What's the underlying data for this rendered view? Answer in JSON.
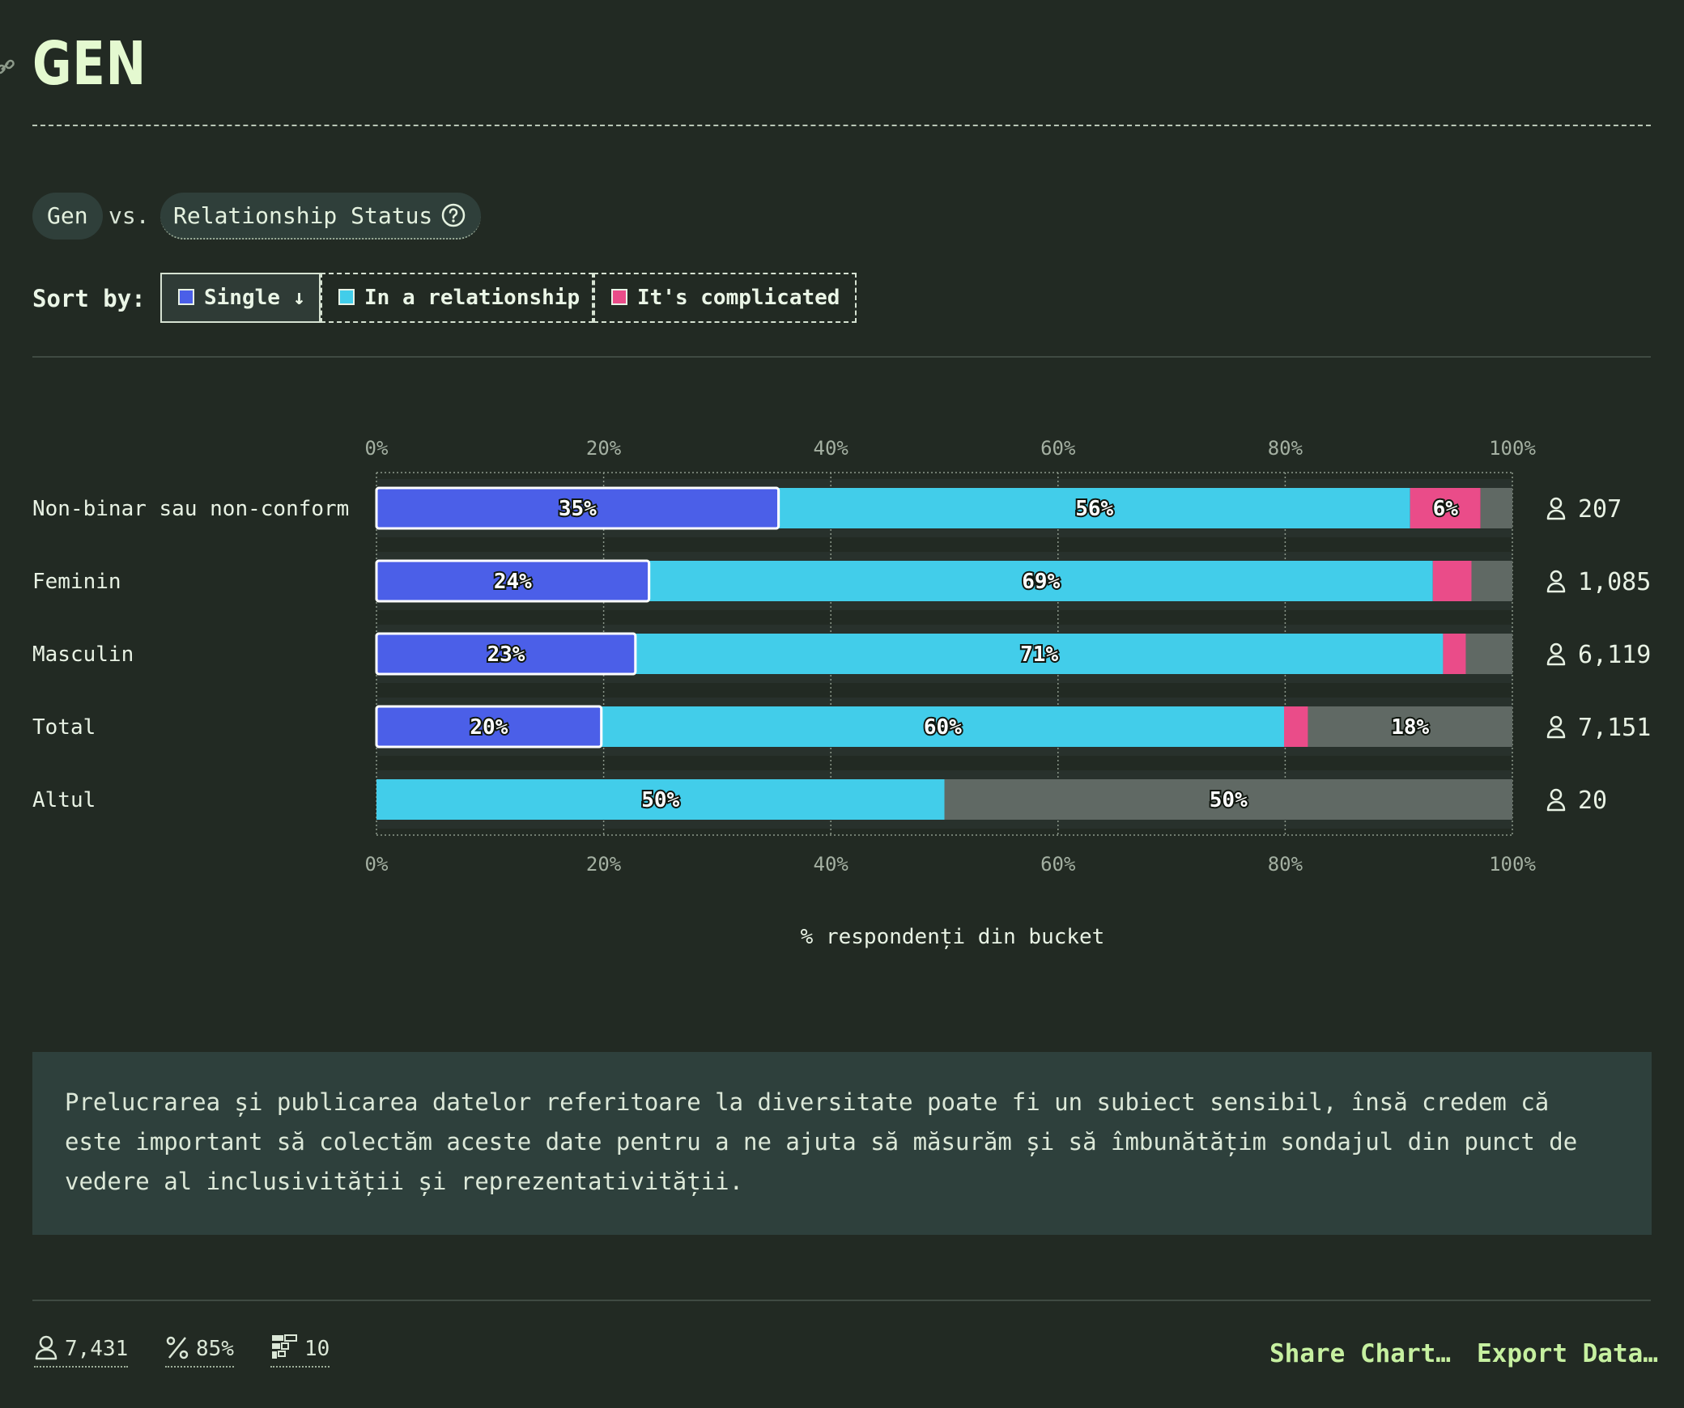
{
  "page": {
    "title": "GEN"
  },
  "comparison": {
    "variable_a": "Gen",
    "vs_label": "vs.",
    "variable_b": "Relationship Status"
  },
  "sort": {
    "label": "Sort by:",
    "options": [
      {
        "label": "Single ↓",
        "color": "#4b5fe8",
        "active": true
      },
      {
        "label": "In a relationship",
        "color": "#42cdea",
        "active": false
      },
      {
        "label": "It's complicated",
        "color": "#ea4c89",
        "active": false
      }
    ]
  },
  "chart_data": {
    "type": "bar",
    "orientation": "horizontal-stacked-100",
    "xlabel": "% respondenți din bucket",
    "xlim": [
      0,
      100
    ],
    "ticks": [
      "0%",
      "20%",
      "40%",
      "60%",
      "80%",
      "100%"
    ],
    "categories": [
      "Non-binar sau non-conform",
      "Feminin",
      "Masculin",
      "Total",
      "Altul"
    ],
    "counts": [
      "207",
      "1,085",
      "6,119",
      "7,151",
      "20"
    ],
    "series": [
      {
        "name": "Single",
        "color": "#4b5fe8",
        "values": [
          35.4,
          24.0,
          22.8,
          19.8,
          0
        ]
      },
      {
        "name": "In a relationship",
        "color": "#42cdea",
        "values": [
          55.6,
          69.0,
          71.1,
          60.1,
          50
        ]
      },
      {
        "name": "It's complicated",
        "color": "#ea4c89",
        "values": [
          6.2,
          3.4,
          2.0,
          2.1,
          0
        ]
      },
      {
        "color": "#606964",
        "values": [
          2.8,
          3.6,
          4.1,
          18.0,
          50
        ]
      }
    ],
    "data_labels": [
      [
        "35%",
        "56%",
        "6%",
        ""
      ],
      [
        "24%",
        "69%",
        "",
        ""
      ],
      [
        "23%",
        "71%",
        "",
        ""
      ],
      [
        "20%",
        "60%",
        "",
        "18%"
      ],
      [
        "",
        "50%",
        "",
        "50%"
      ]
    ],
    "grid": true
  },
  "note": {
    "text": "Prelucrarea și publicarea datelor referitoare la diversitate poate fi un subiect sensibil, însă credem că este important să colectăm aceste date pentru a ne ajuta să măsurăm și să îmbunătățim sondajul din punct de vedere al inclusivității și reprezentativității."
  },
  "footer": {
    "respondents": "7,431",
    "percentage": "85%",
    "questions": "10",
    "share_label": "Share Chart…",
    "export_label": "Export Data…"
  }
}
